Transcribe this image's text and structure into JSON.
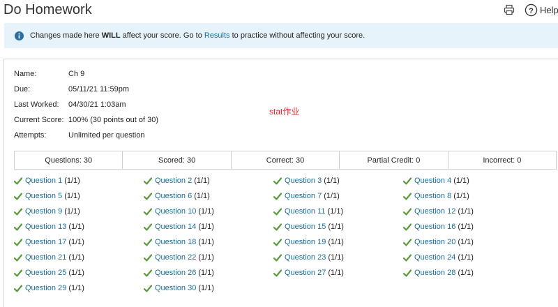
{
  "header": {
    "title": "Do Homework",
    "help_label": "Help"
  },
  "banner": {
    "text_before": "Changes made here ",
    "text_bold": "WILL",
    "text_middle": " affect your score. Go to ",
    "link_label": "Results",
    "text_after": " to practice without affecting your score."
  },
  "info": {
    "name_label": "Name:",
    "name_value": "Ch 9",
    "due_label": "Due:",
    "due_value": "05/11/21 11:59pm",
    "last_worked_label": "Last Worked:",
    "last_worked_value": "04/30/21 1:03am",
    "current_score_label": "Current Score:",
    "current_score_value": "100% (30 points out of 30)",
    "attempts_label": "Attempts:",
    "attempts_value": "Unlimited per question"
  },
  "note": "stat作业",
  "summary": {
    "questions": "Questions: 30",
    "scored": "Scored: 30",
    "correct": "Correct: 30",
    "partial": "Partial Credit: 0",
    "incorrect": "Incorrect: 0"
  },
  "questions": [
    {
      "label": "Question 1",
      "score": "(1/1)"
    },
    {
      "label": "Question 2",
      "score": "(1/1)"
    },
    {
      "label": "Question 3",
      "score": "(1/1)"
    },
    {
      "label": "Question 4",
      "score": "(1/1)"
    },
    {
      "label": "Question 5",
      "score": "(1/1)"
    },
    {
      "label": "Question 6",
      "score": "(1/1)"
    },
    {
      "label": "Question 7",
      "score": "(1/1)"
    },
    {
      "label": "Question 8",
      "score": "(1/1)"
    },
    {
      "label": "Question 9",
      "score": "(1/1)"
    },
    {
      "label": "Question 10",
      "score": "(1/1)"
    },
    {
      "label": "Question 11",
      "score": "(1/1)"
    },
    {
      "label": "Question 12",
      "score": "(1/1)"
    },
    {
      "label": "Question 13",
      "score": "(1/1)"
    },
    {
      "label": "Question 14",
      "score": "(1/1)"
    },
    {
      "label": "Question 15",
      "score": "(1/1)"
    },
    {
      "label": "Question 16",
      "score": "(1/1)"
    },
    {
      "label": "Question 17",
      "score": "(1/1)"
    },
    {
      "label": "Question 18",
      "score": "(1/1)"
    },
    {
      "label": "Question 19",
      "score": "(1/1)"
    },
    {
      "label": "Question 20",
      "score": "(1/1)"
    },
    {
      "label": "Question 21",
      "score": "(1/1)"
    },
    {
      "label": "Question 22",
      "score": "(1/1)"
    },
    {
      "label": "Question 23",
      "score": "(1/1)"
    },
    {
      "label": "Question 24",
      "score": "(1/1)"
    },
    {
      "label": "Question 25",
      "score": "(1/1)"
    },
    {
      "label": "Question 26",
      "score": "(1/1)"
    },
    {
      "label": "Question 27",
      "score": "(1/1)"
    },
    {
      "label": "Question 28",
      "score": "(1/1)"
    },
    {
      "label": "Question 29",
      "score": "(1/1)"
    },
    {
      "label": "Question 30",
      "score": "(1/1)"
    }
  ],
  "colors": {
    "link": "#1a6e9c",
    "check": "#5a9a3c",
    "banner_bg": "#e6f3fa",
    "note": "#e0262d"
  },
  "icons": {
    "print": "printer-icon",
    "help": "question-circle-icon",
    "info": "info-circle-icon",
    "check": "checkmark-icon"
  }
}
